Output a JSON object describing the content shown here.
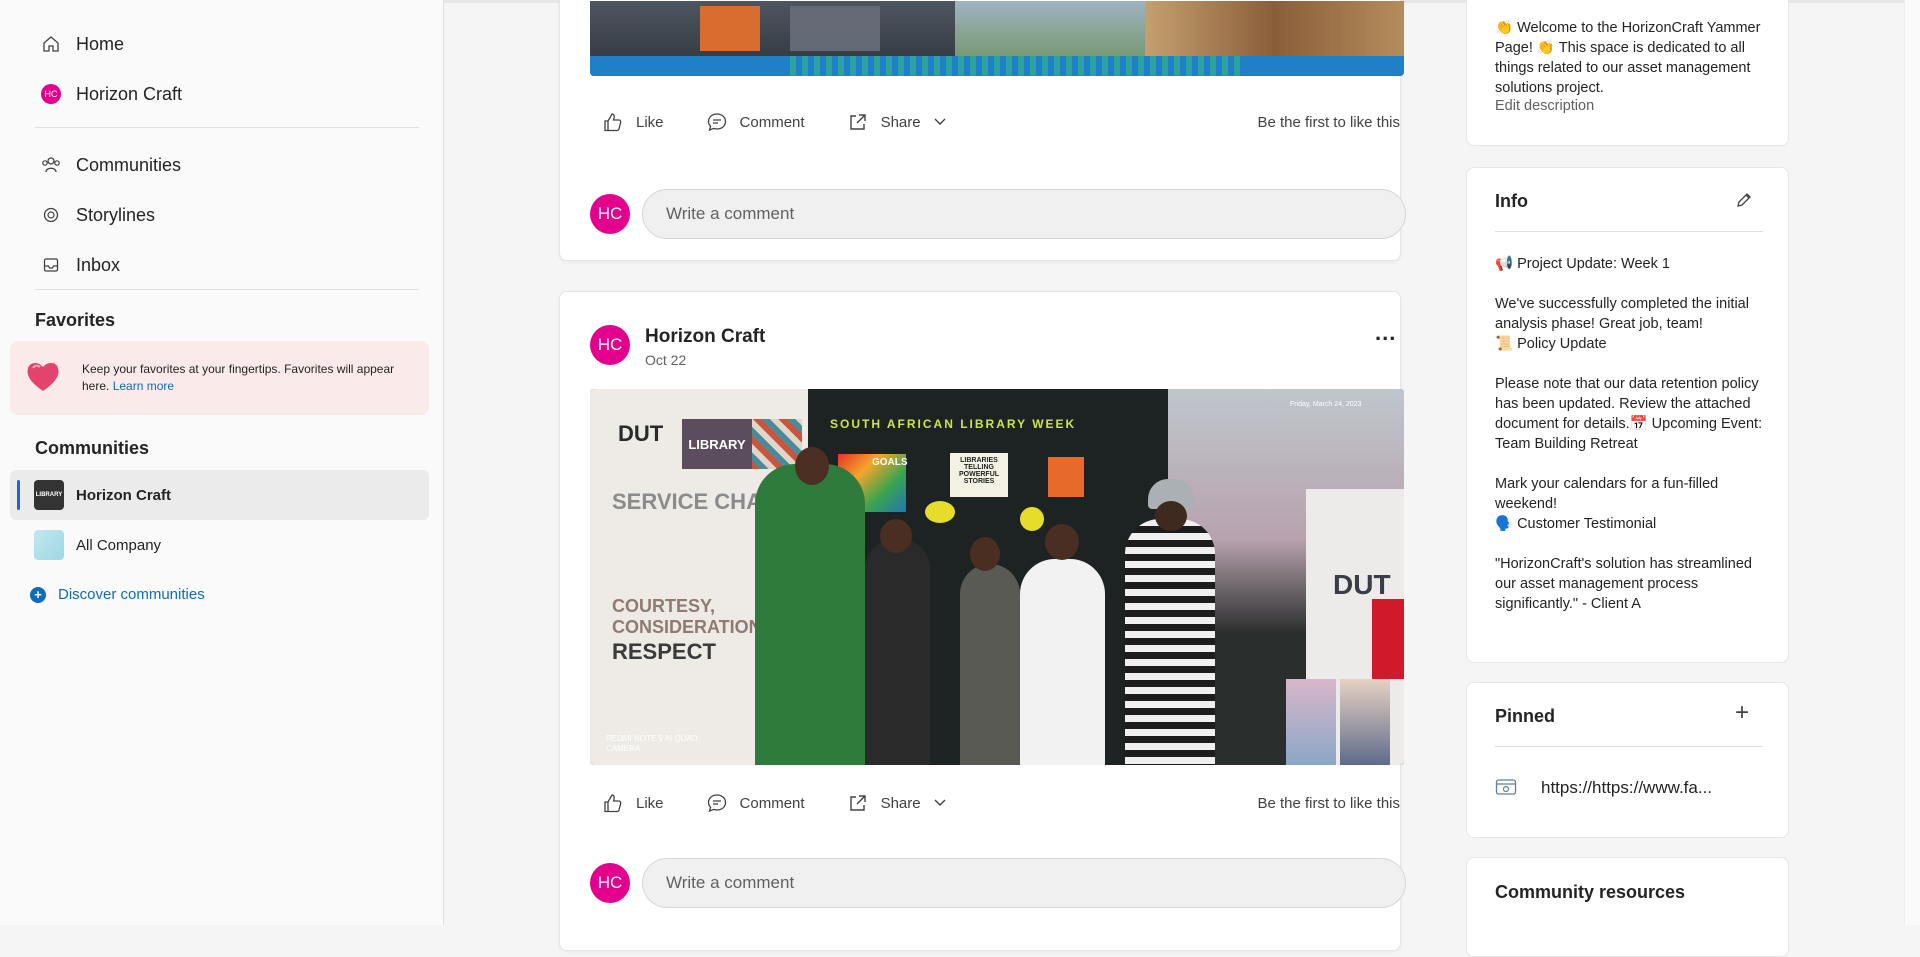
{
  "sidebar": {
    "nav": [
      {
        "label": "Home",
        "icon": "home-icon"
      },
      {
        "label": "Horizon Craft",
        "icon": "hc-avatar"
      },
      {
        "label": "Communities",
        "icon": "communities-icon"
      },
      {
        "label": "Storylines",
        "icon": "storylines-icon"
      },
      {
        "label": "Inbox",
        "icon": "inbox-icon"
      }
    ],
    "hc_badge": "HC",
    "favorites_title": "Favorites",
    "favorites_text": "Keep your favorites at your fingertips. Favorites will appear here.",
    "favorites_link": "Learn more",
    "communities_title": "Communities",
    "communities": [
      {
        "label": "Horizon Craft",
        "thumb_text": "LIBRARY"
      },
      {
        "label": "All Company"
      }
    ],
    "discover_label": "Discover communities"
  },
  "feed": {
    "actions": {
      "like": "Like",
      "comment": "Comment",
      "share": "Share"
    },
    "first_like_text": "Be the first to like this",
    "comment_placeholder": "Write a comment",
    "avatar_initials": "HC",
    "post": {
      "author": "Horizon Craft",
      "date": "Oct 22",
      "more": "...",
      "image_texts": {
        "library_week": "SOUTH AFRICAN LIBRARY WEEK",
        "dut": "DUT",
        "library": "LIBRARY",
        "service": "SERVICE CHARTER",
        "courtesy": "COURTESY,",
        "consideration": "CONSIDERATION,",
        "respect": "RESPECT",
        "libraries_telling": "LIBRARIES TELLING POWERFUL STORIES",
        "goals": "GOALS",
        "date_stamp": "Friday, March 24, 2023",
        "camera": "REDMI NOTE 9 AI QUAD CAMERA"
      }
    }
  },
  "right": {
    "description": "👏 Welcome to the HorizonCraft Yammer Page! 👏 This space is dedicated to all things related to our asset management solutions project.",
    "edit_description": "Edit description",
    "info_title": "Info",
    "info_lines": [
      "📢 Project Update: Week 1",
      "",
      "We've successfully completed the initial analysis phase! Great job, team!",
      "📜 Policy Update",
      "",
      "Please note that our data retention policy has been updated. Review the attached document for details.📅 Upcoming Event: Team Building Retreat",
      "",
      "Mark your calendars for a fun-filled weekend!",
      "🗣️ Customer Testimonial",
      "",
      "\"HorizonCraft's solution has streamlined our asset management process significantly.\" - Client A"
    ],
    "pinned_title": "Pinned",
    "pinned_link": "https://https://www.fa...",
    "resources_title": "Community resources"
  },
  "colors": {
    "accent": "#e3008c",
    "link": "#0f6cbd",
    "active_bar": "#2266cc"
  }
}
